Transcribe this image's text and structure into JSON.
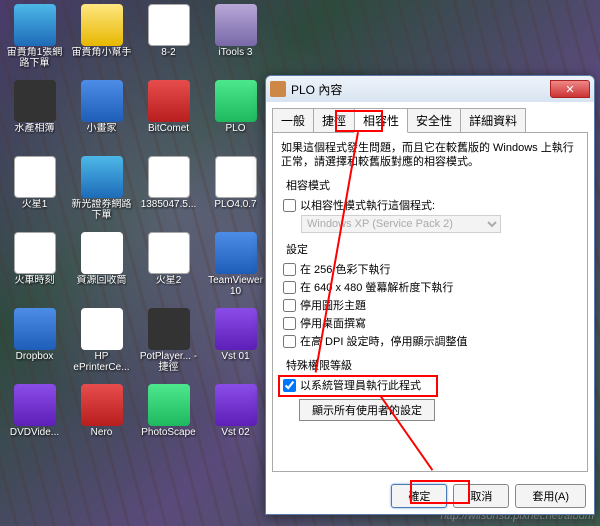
{
  "desktop": {
    "icons": [
      {
        "label": "宙貴角1張網路下單",
        "cls": "ie"
      },
      {
        "label": "宙貴角小幫手",
        "cls": "folder"
      },
      {
        "label": "8-2",
        "cls": "note"
      },
      {
        "label": "iTools 3",
        "cls": "app1"
      },
      {
        "label": "水產相簿",
        "cls": "app2"
      },
      {
        "label": "小畫家",
        "cls": "app5"
      },
      {
        "label": "BitComet",
        "cls": "app3"
      },
      {
        "label": "PLO",
        "cls": "app4"
      },
      {
        "label": "火星1",
        "cls": "note"
      },
      {
        "label": "新光證券網路下單",
        "cls": "ie"
      },
      {
        "label": "1385047.5...",
        "cls": "note"
      },
      {
        "label": "PLO4.0.7",
        "cls": "note"
      },
      {
        "label": "火車時刻",
        "cls": "note"
      },
      {
        "label": "資源回收筒",
        "cls": "app6"
      },
      {
        "label": "火星2",
        "cls": "note"
      },
      {
        "label": "TeamViewer 10",
        "cls": "app5"
      },
      {
        "label": "Dropbox",
        "cls": "app5"
      },
      {
        "label": "HP ePrinterCe...",
        "cls": "app6"
      },
      {
        "label": "PotPlayer... - 捷徑",
        "cls": "app2"
      },
      {
        "label": "Vst 01",
        "cls": "app7"
      },
      {
        "label": "DVDVide...",
        "cls": "app7"
      },
      {
        "label": "Nero",
        "cls": "app3"
      },
      {
        "label": "PhotoScape",
        "cls": "app4"
      },
      {
        "label": "Vst 02",
        "cls": "app7"
      }
    ]
  },
  "window": {
    "title": "PLO 內容",
    "tabs": [
      "一般",
      "捷徑",
      "相容性",
      "安全性",
      "詳細資料"
    ],
    "active_tab": "相容性",
    "intro": "如果這個程式發生問題，而且它在較舊版的 Windows 上執行正常，請選擇和較舊版對應的相容模式。",
    "group_compat": "相容模式",
    "cb_compat": "以相容性模式執行這個程式:",
    "sel_compat": "Windows XP (Service Pack 2)",
    "group_settings": "設定",
    "cb_256": "在 256 色彩下執行",
    "cb_640": "在 640 x 480 螢幕解析度下執行",
    "cb_theme": "停用圖形主題",
    "cb_dwm": "停用桌面撰寫",
    "cb_dpi": "在高 DPI 設定時，停用顯示調整值",
    "group_priv": "特殊權限等級",
    "cb_admin": "以系統管理員執行此程式",
    "btn_allusers": "顯示所有使用者的設定",
    "btn_ok": "確定",
    "btn_cancel": "取消",
    "btn_apply": "套用(A)"
  },
  "watermark": "http://wilsonsu.pixnet.net/album"
}
